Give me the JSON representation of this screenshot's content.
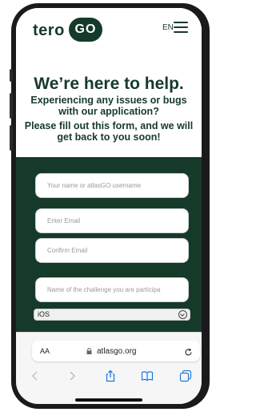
{
  "header": {
    "logo_text": "tero",
    "logo_badge": "GO",
    "language": "EN",
    "menu_icon": "hamburger-menu-icon"
  },
  "hero": {
    "title": "We’re here to help.",
    "subtitle": "Experiencing any issues or bugs with our application?",
    "instruction": "Please fill out this form, and we will get back to you soon!"
  },
  "form": {
    "name_placeholder": "Your name or atlasGO username",
    "email_placeholder": "Enter Email",
    "confirm_email_placeholder": "Confirm Email",
    "challenge_placeholder": "Name of the challenge you are participa",
    "platform_selected": "iOS"
  },
  "safari": {
    "text_size_label": "AA",
    "url": "atlasgo.org",
    "icons": [
      "back-icon",
      "forward-icon",
      "share-icon",
      "bookmarks-icon",
      "tabs-icon"
    ]
  },
  "colors": {
    "brand": "#163a2a",
    "background": "#ffffff",
    "field_background": "#ffffff"
  }
}
